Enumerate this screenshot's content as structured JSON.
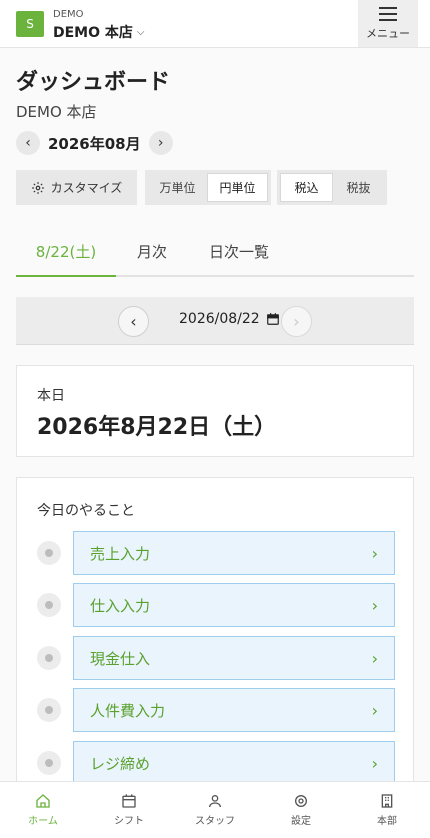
{
  "header": {
    "logo_letter": "S",
    "org_sub": "DEMO",
    "org_name": "DEMO 本店",
    "org_chevron": "⌵",
    "menu_label": "メニュー"
  },
  "page": {
    "title": "ダッシュボード",
    "store": "DEMO 本店"
  },
  "month_nav": {
    "prev": "‹",
    "label": "2026年08月",
    "next": "›"
  },
  "toolbar": {
    "customize_label": "カスタマイズ",
    "unit_options": [
      {
        "label": "万単位",
        "active": false
      },
      {
        "label": "円単位",
        "active": true
      }
    ],
    "tax_options": [
      {
        "label": "税込",
        "active": true
      },
      {
        "label": "税抜",
        "active": false
      }
    ]
  },
  "tabs": [
    {
      "label": "8/22(土)",
      "active": true
    },
    {
      "label": "月次",
      "active": false
    },
    {
      "label": "日次一覧",
      "active": false
    }
  ],
  "date_nav": {
    "prev": "‹",
    "value": "2026/08/22",
    "next": "›"
  },
  "today": {
    "label": "本日",
    "date": "2026年8月22日（土）"
  },
  "todo": {
    "title": "今日のやること",
    "items": [
      {
        "label": "売上入力"
      },
      {
        "label": "仕入入力"
      },
      {
        "label": "現金仕入"
      },
      {
        "label": "人件費入力"
      },
      {
        "label": "レジ締め"
      }
    ]
  },
  "bottom_nav": [
    {
      "label": "ホーム",
      "icon": "home-icon",
      "active": true
    },
    {
      "label": "シフト",
      "icon": "calendar-icon",
      "active": false
    },
    {
      "label": "スタッフ",
      "icon": "person-icon",
      "active": false
    },
    {
      "label": "設定",
      "icon": "gear-icon",
      "active": false
    },
    {
      "label": "本部",
      "icon": "building-icon",
      "active": false
    }
  ],
  "colors": {
    "accent": "#6cb33e",
    "todo_bg": "#e9f4fc",
    "todo_border": "#9fcdee"
  }
}
